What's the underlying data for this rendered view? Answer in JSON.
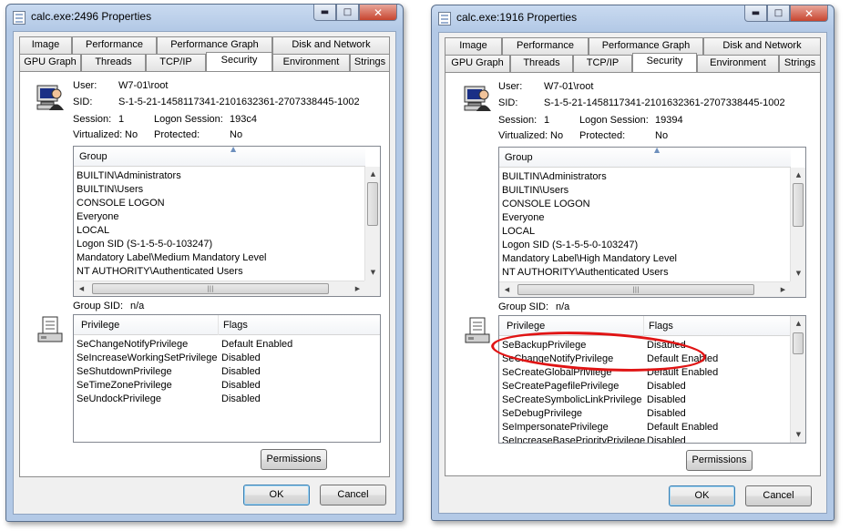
{
  "windows": [
    {
      "title": "calc.exe:2496 Properties",
      "tabs_row1": [
        "Image",
        "Performance",
        "Performance Graph",
        "Disk and Network"
      ],
      "tabs_row2": [
        "GPU Graph",
        "Threads",
        "TCP/IP",
        "Security",
        "Environment",
        "Strings"
      ],
      "active_tab": "Security",
      "user_label": "User:",
      "user_value": "W7-01\\root",
      "sid_label": "SID:",
      "sid_value": "S-1-5-21-1458117341-2101632361-2707338445-1002",
      "session_label": "Session:",
      "session_value": "1",
      "logon_label": "Logon Session:",
      "logon_value": "193c4",
      "virtualized_label": "Virtualized:",
      "virtualized_value": "No",
      "protected_label": "Protected:",
      "protected_value": "No",
      "group_header": "Group",
      "groups": [
        "BUILTIN\\Administrators",
        "BUILTIN\\Users",
        "CONSOLE LOGON",
        "Everyone",
        "LOCAL",
        "Logon SID (S-1-5-5-0-103247)",
        "Mandatory Label\\Medium Mandatory Level",
        "NT AUTHORITY\\Authenticated Users"
      ],
      "group_sid_label": "Group SID:",
      "group_sid_value": "n/a",
      "priv_header": "Privilege",
      "flags_header": "Flags",
      "privileges": [
        {
          "name": "SeChangeNotifyPrivilege",
          "flags": "Default Enabled"
        },
        {
          "name": "SeIncreaseWorkingSetPrivilege",
          "flags": "Disabled"
        },
        {
          "name": "SeShutdownPrivilege",
          "flags": "Disabled"
        },
        {
          "name": "SeTimeZonePrivilege",
          "flags": "Disabled"
        },
        {
          "name": "SeUndockPrivilege",
          "flags": "Disabled"
        }
      ],
      "permissions_label": "Permissions",
      "ok_label": "OK",
      "cancel_label": "Cancel"
    },
    {
      "title": "calc.exe:1916 Properties",
      "tabs_row1": [
        "Image",
        "Performance",
        "Performance Graph",
        "Disk and Network"
      ],
      "tabs_row2": [
        "GPU Graph",
        "Threads",
        "TCP/IP",
        "Security",
        "Environment",
        "Strings"
      ],
      "active_tab": "Security",
      "user_label": "User:",
      "user_value": "W7-01\\root",
      "sid_label": "SID:",
      "sid_value": "S-1-5-21-1458117341-2101632361-2707338445-1002",
      "session_label": "Session:",
      "session_value": "1",
      "logon_label": "Logon Session:",
      "logon_value": "19394",
      "virtualized_label": "Virtualized:",
      "virtualized_value": "No",
      "protected_label": "Protected:",
      "protected_value": "No",
      "group_header": "Group",
      "groups": [
        "BUILTIN\\Administrators",
        "BUILTIN\\Users",
        "CONSOLE LOGON",
        "Everyone",
        "LOCAL",
        "Logon SID (S-1-5-5-0-103247)",
        "Mandatory Label\\High Mandatory Level",
        "NT AUTHORITY\\Authenticated Users"
      ],
      "group_sid_label": "Group SID:",
      "group_sid_value": "n/a",
      "priv_header": "Privilege",
      "flags_header": "Flags",
      "privileges": [
        {
          "name": "SeBackupPrivilege",
          "flags": "Disabled"
        },
        {
          "name": "SeChangeNotifyPrivilege",
          "flags": "Default Enabled"
        },
        {
          "name": "SeCreateGlobalPrivilege",
          "flags": "Default Enabled"
        },
        {
          "name": "SeCreatePagefilePrivilege",
          "flags": "Disabled"
        },
        {
          "name": "SeCreateSymbolicLinkPrivilege",
          "flags": "Disabled"
        },
        {
          "name": "SeDebugPrivilege",
          "flags": "Disabled"
        },
        {
          "name": "SeImpersonatePrivilege",
          "flags": "Default Enabled"
        },
        {
          "name": "SeIncreaseBasePriorityPrivilege",
          "flags": "Disabled"
        }
      ],
      "permissions_label": "Permissions",
      "ok_label": "OK",
      "cancel_label": "Cancel"
    }
  ],
  "colors": {
    "highlight_ellipse": "#e01414",
    "title_bar": "#b3c9e6",
    "close_button": "#c7452f"
  },
  "icons": [
    "window-app-icon",
    "user-monitor-icon",
    "privilege-doc-icon",
    "minimize-icon",
    "maximize-icon",
    "close-icon",
    "sort-arrow-icon",
    "scroll-up-icon",
    "scroll-down-icon",
    "scroll-left-icon",
    "scroll-right-icon"
  ]
}
